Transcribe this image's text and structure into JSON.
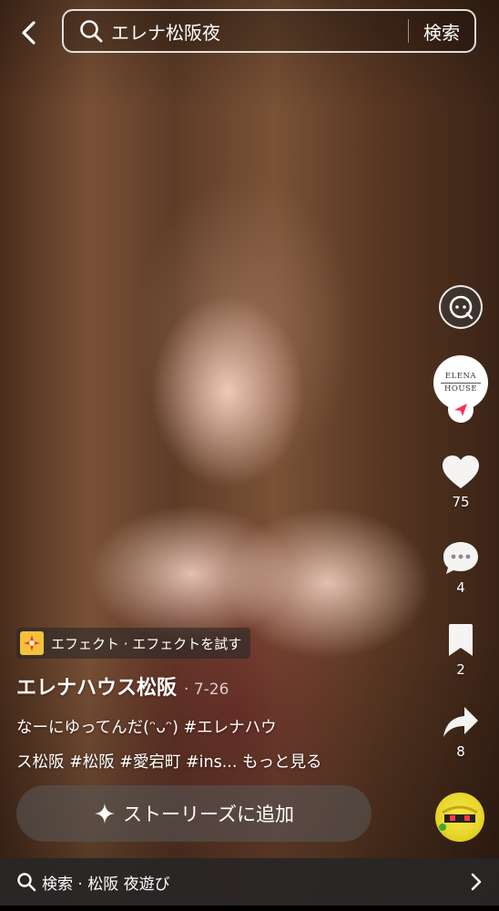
{
  "search": {
    "query": "エレナ松阪夜",
    "submit_label": "検索"
  },
  "right_rail": {
    "account_logo": [
      "ELENA",
      "HOUSE"
    ],
    "likes": "75",
    "comments": "4",
    "bookmarks": "2",
    "shares": "8"
  },
  "effect": {
    "label": "エフェクト · エフェクトを試す"
  },
  "post": {
    "author": "エレナハウス松阪",
    "date": "· 7-26",
    "caption_line1": "なーにゆってんだ(ᵔᴗᵔ)   #エレナハウ",
    "caption_line2": "ス松阪 #松阪 #愛宕町 #ins... もっと見る"
  },
  "story_button": {
    "label": "ストーリーズに追加"
  },
  "bottom_bar": {
    "text": "検索 · 松阪 夜遊び"
  },
  "colors": {
    "accent_red": "#ff2d55",
    "effect_yellow": "#f3c23a"
  },
  "icons": [
    "back-arrow-icon",
    "search-icon",
    "chat-bubble-icon",
    "follow-icon",
    "heart-icon",
    "comment-icon",
    "bookmark-icon",
    "share-icon",
    "music-icon",
    "sparkle-icon",
    "chevron-right-icon"
  ]
}
